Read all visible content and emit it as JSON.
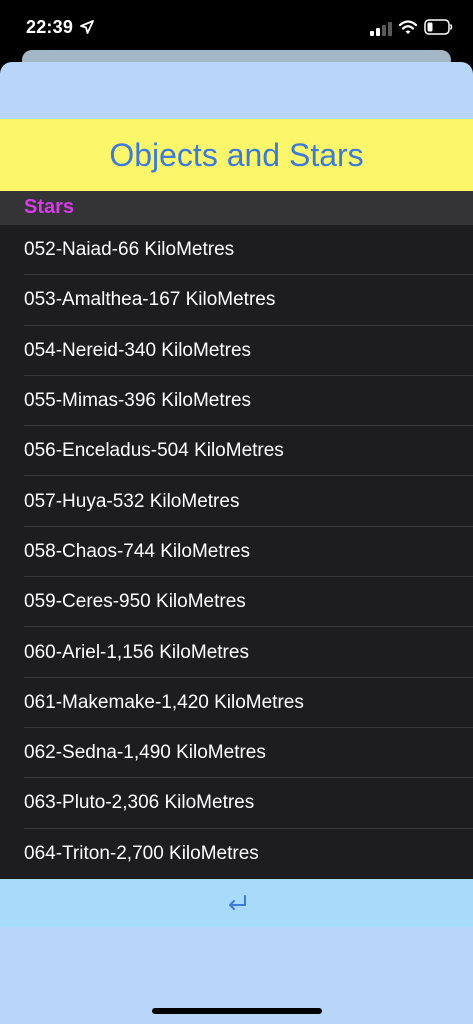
{
  "status_bar": {
    "time": "22:39",
    "icons": [
      "location-arrow-icon",
      "cellular-signal-icon",
      "wifi-icon",
      "battery-icon"
    ]
  },
  "header": {
    "title": "Objects and Stars"
  },
  "section": {
    "title": "Stars"
  },
  "list": {
    "items": [
      "052-Naiad-66 KiloMetres",
      "053-Amalthea-167 KiloMetres",
      "054-Nereid-340 KiloMetres",
      "055-Mimas-396 KiloMetres",
      "056-Enceladus-504 KiloMetres",
      "057-Huya-532 KiloMetres",
      "058-Chaos-744 KiloMetres",
      "059-Ceres-950 KiloMetres",
      "060-Ariel-1,156 KiloMetres",
      "061-Makemake-1,420 KiloMetres",
      "062-Sedna-1,490 KiloMetres",
      "063-Pluto-2,306 KiloMetres",
      "064-Triton-2,700 KiloMetres"
    ]
  },
  "toolbar": {
    "icon": "return-arrow-icon"
  },
  "colors": {
    "sheet_background": "#b8d7f8",
    "title_background": "#fcf66b",
    "title_text": "#3d7bd8",
    "section_text": "#d63ce8",
    "list_background": "#1d1d1f",
    "toolbar_background": "#a8daf9"
  }
}
